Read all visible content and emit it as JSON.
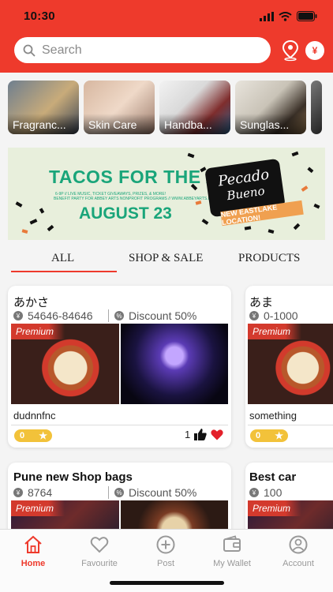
{
  "status_bar": {
    "time": "10:30"
  },
  "header": {
    "search_placeholder": "Search",
    "currency_symbol": "¥",
    "accent_color": "#ee3a2c"
  },
  "categories": [
    {
      "label": "Fragranc..."
    },
    {
      "label": "Skin Care"
    },
    {
      "label": "Handba..."
    },
    {
      "label": "Sunglas..."
    }
  ],
  "banner": {
    "title": "TACOS FOR THE ARTS",
    "line1": "6-9P // LIVE MUSIC, TICKET GIVEAWAYS, PRIZES, & MORE!",
    "line2": "BENEFIT PARTY FOR ABBEY ARTS NONPROFIT PROGRAMS // WWW.ABBEYARTS.ME",
    "date": "AUGUST 23",
    "logo_line1": "Pecado",
    "logo_line2": "Bueno",
    "tag": "NEW EASTLAKE LOCATION!"
  },
  "tabs": [
    {
      "label": "ALL",
      "active": true
    },
    {
      "label": "SHOP & SALE",
      "active": false
    },
    {
      "label": "PRODUCTS",
      "active": false
    }
  ],
  "shops": [
    {
      "name": "あかさ",
      "price_icon": "¥",
      "price": "54646-84646",
      "discount_icon": "%",
      "discount": "Discount 50%",
      "badge": "Premium",
      "description": "dudnnfnc",
      "rating": "0",
      "likes": "1"
    },
    {
      "name": "あま",
      "price_icon": "¥",
      "price": "0-1000",
      "badge": "Premium",
      "description": "something",
      "rating": "0"
    },
    {
      "name": "Pune new Shop bags",
      "price_icon": "¥",
      "price": "8764",
      "discount_icon": "%",
      "discount": "Discount 50%",
      "badge": "Premium"
    },
    {
      "name": "Best car",
      "price_icon": "¥",
      "price": "100",
      "badge": "Premium"
    }
  ],
  "bottom_nav": [
    {
      "label": "Home",
      "icon": "home-icon",
      "active": true
    },
    {
      "label": "Favourite",
      "icon": "heart-icon",
      "active": false
    },
    {
      "label": "Post",
      "icon": "plus-circle-icon",
      "active": false
    },
    {
      "label": "My Wallet",
      "icon": "wallet-icon",
      "active": false
    },
    {
      "label": "Account",
      "icon": "user-icon",
      "active": false
    }
  ]
}
